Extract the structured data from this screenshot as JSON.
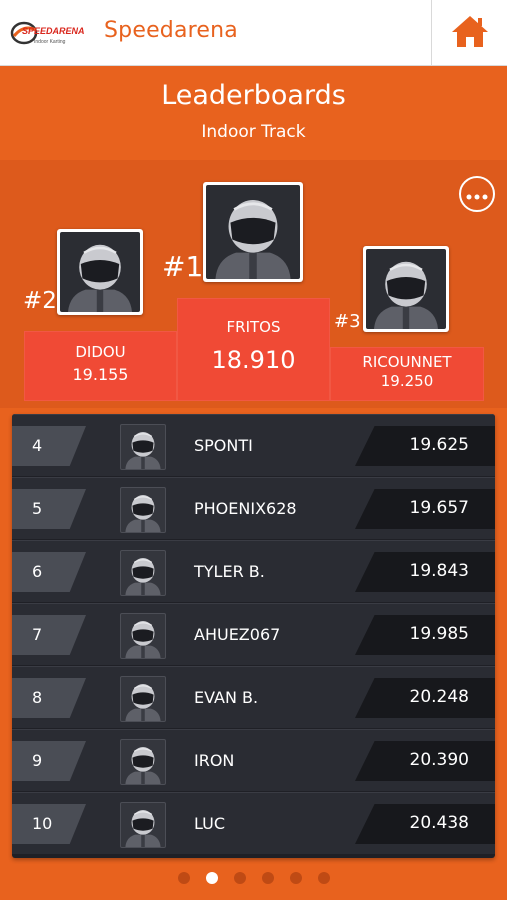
{
  "app": {
    "name": "Speedarena",
    "logo_text": "SPEEDARENA",
    "logo_subtext": "Indoor Karting"
  },
  "header": {
    "title": "Leaderboards",
    "subtitle": "Indoor Track"
  },
  "podium": [
    {
      "rank": "#1",
      "name": "FRITOS",
      "time": "18.910"
    },
    {
      "rank": "#2",
      "name": "DIDOU",
      "time": "19.155"
    },
    {
      "rank": "#3",
      "name": "RICOUNNET",
      "time": "19.250"
    }
  ],
  "leaderboard": [
    {
      "position": "4",
      "name": "SPONTI",
      "time": "19.625"
    },
    {
      "position": "5",
      "name": "PHOENIX628",
      "time": "19.657"
    },
    {
      "position": "6",
      "name": "TYLER B.",
      "time": "19.843"
    },
    {
      "position": "7",
      "name": "AHUEZ067",
      "time": "19.985"
    },
    {
      "position": "8",
      "name": "EVAN B.",
      "time": "20.248"
    },
    {
      "position": "9",
      "name": "IRON",
      "time": "20.390"
    },
    {
      "position": "10",
      "name": "LUC",
      "time": "20.438"
    }
  ],
  "pager": {
    "pages": 6,
    "active": 1
  },
  "colors": {
    "accent": "#e8621e",
    "podium_plate": "#f04a35",
    "list_bg": "#2a2c33"
  },
  "icons": {
    "home": "home-icon",
    "more": "more-icon",
    "avatar": "helmet-avatar-icon"
  }
}
